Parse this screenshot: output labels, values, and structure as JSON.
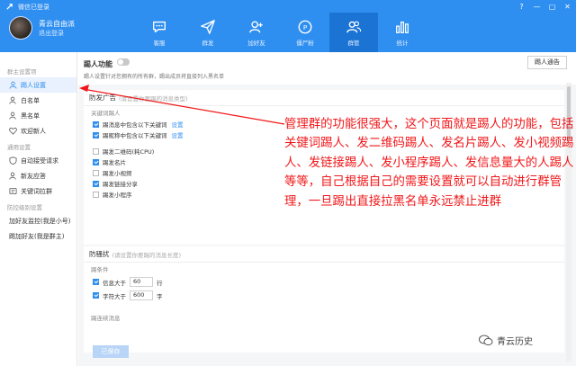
{
  "app": {
    "title": "微信已登录"
  },
  "window_controls": [
    "?",
    "—",
    "▢",
    "✕"
  ],
  "profile": {
    "name": "青云自由派",
    "logout": "退出登录"
  },
  "nav": [
    {
      "label": "客服",
      "icon": "chat-bubble-icon"
    },
    {
      "label": "群发",
      "icon": "paper-plane-icon"
    },
    {
      "label": "加好友",
      "icon": "add-user-icon"
    },
    {
      "label": "僵尸粉",
      "icon": "zombie-badge-icon"
    },
    {
      "label": "群管",
      "icon": "group-users-icon",
      "active": true
    },
    {
      "label": "统计",
      "icon": "bar-stats-icon"
    }
  ],
  "sidebar": {
    "group1": "群主设置项",
    "items1": [
      {
        "label": "踢人设置",
        "active": true
      },
      {
        "label": "白名单"
      },
      {
        "label": "黑名单"
      },
      {
        "label": "欢迎新人"
      }
    ],
    "group2": "通用设置",
    "items2": [
      {
        "label": "自动接受请求"
      },
      {
        "label": "新友应答"
      },
      {
        "label": "关键词拉群"
      }
    ],
    "group3": "防控级别设置",
    "items3": [
      {
        "label": "加好友监控(我是小号)"
      },
      {
        "label": "踢加好友(我是群主)"
      }
    ]
  },
  "kick": {
    "title": "踢人功能",
    "desc": "踢人设置针对您拥有的所有群，踢出成员将直接列入黑名单",
    "notice_button": "踢人通告"
  },
  "ad": {
    "title": "防发广告",
    "hint": "(请设置你要踢的消息类型)",
    "keyword_label": "关键词踢人",
    "keyword_rows": [
      {
        "label": "踢消息中包含以下关键词",
        "link": "设置",
        "checked": true
      },
      {
        "label": "踢昵称中包含以下关键词",
        "link": "设置",
        "checked": true
      }
    ],
    "type_rows": [
      {
        "label": "踢发二维码(耗CPU)",
        "checked": false
      },
      {
        "label": "踢发名片",
        "checked": true
      },
      {
        "label": "踢发小视频",
        "checked": false
      },
      {
        "label": "踢发链接分享",
        "checked": true
      },
      {
        "label": "踢发小程序",
        "checked": false
      }
    ]
  },
  "spam": {
    "title": "防骚扰",
    "hint": "(请设置你要踢的消息长度)",
    "sub_label": "踢条件",
    "rows": [
      {
        "prefix": "信息大于",
        "value": "60",
        "suffix": "行",
        "checked": true
      },
      {
        "prefix": "字符大于",
        "value": "600",
        "suffix": "字",
        "checked": true
      }
    ],
    "sub_label2": "踢连续消息"
  },
  "save_button": "已保存",
  "annotation": "管理群的功能很强大，这个页面就是踢人的功能，包括关键词踢人、发二维码踢人、发名片踢人、发小视频踢人、发链接踢人、发小程序踢人、发信息量大的人踢人等等，自己根据自己的需要设置就可以自动进行群管理，一旦踢出直接拉黑名单永远禁止进群",
  "watermark": "青云历史",
  "colors": {
    "header": "#2f8ff0",
    "nav_active": "#1b73d4",
    "annotation": "#f0171a",
    "link": "#2f8ff0"
  }
}
